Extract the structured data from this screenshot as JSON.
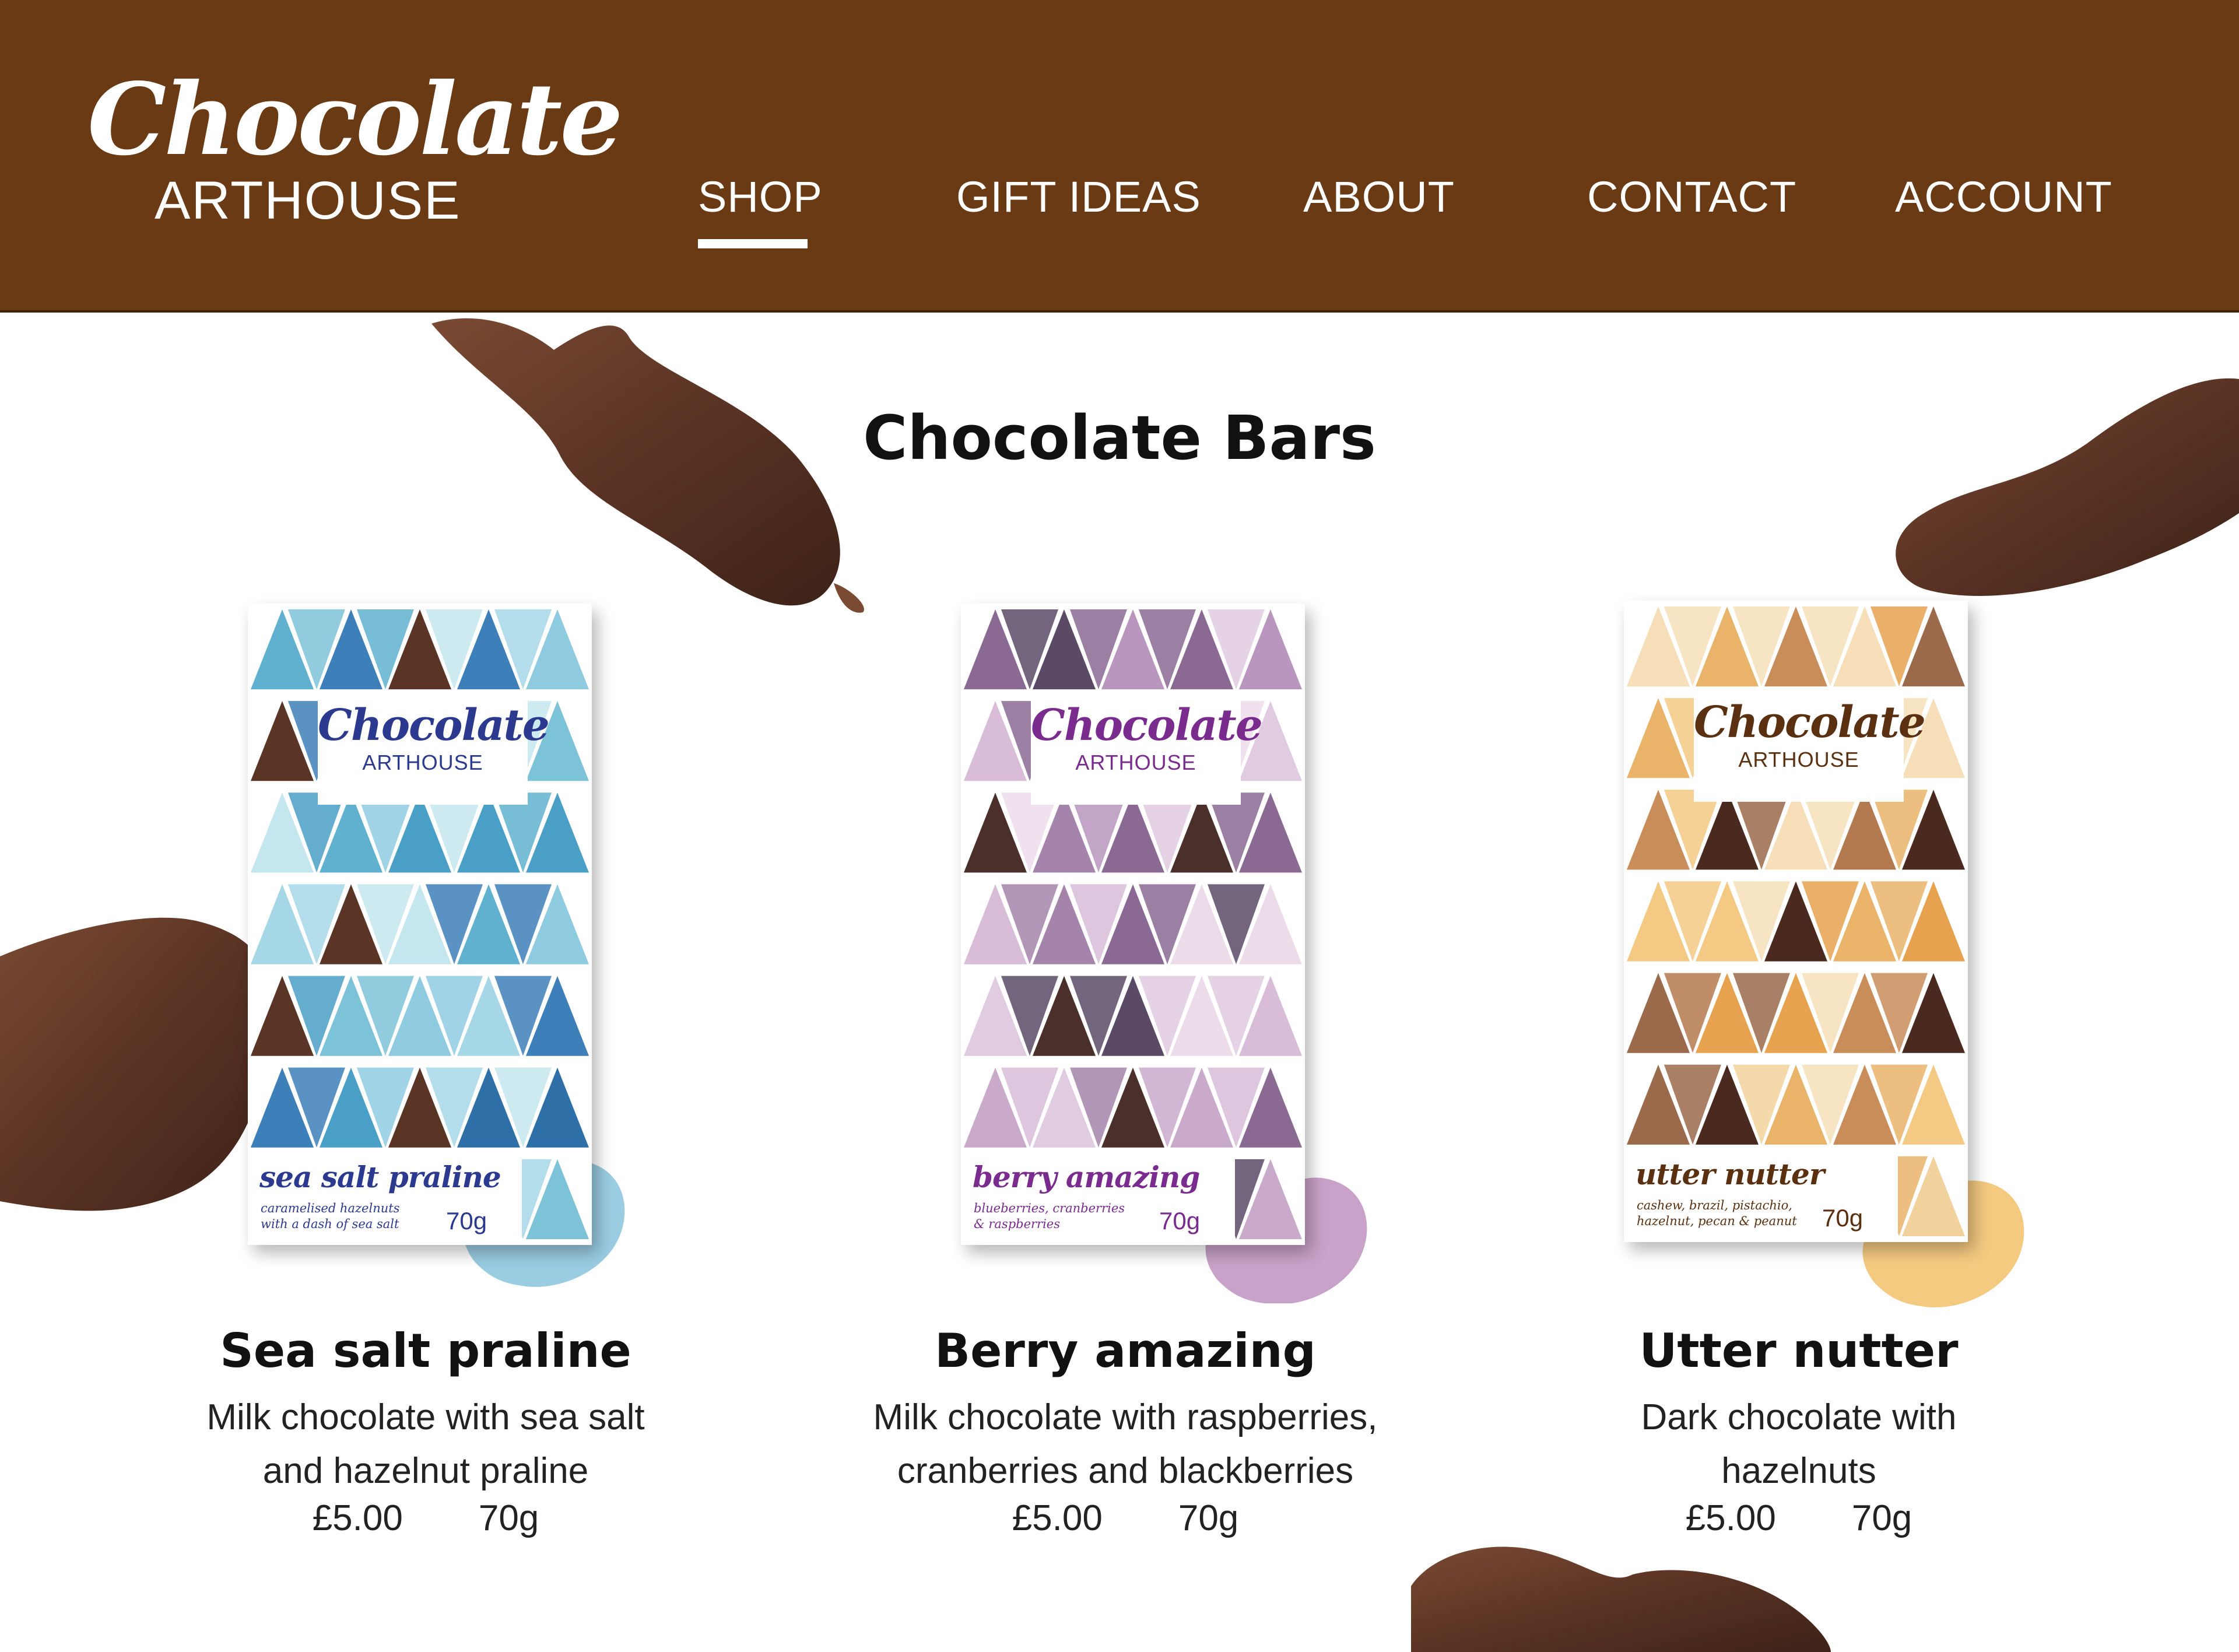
{
  "brand": {
    "script": "Chocolate",
    "sub": "ARTHOUSE"
  },
  "nav": {
    "items": [
      {
        "label": "SHOP",
        "active": true
      },
      {
        "label": "GIFT IDEAS",
        "active": false
      },
      {
        "label": "ABOUT",
        "active": false
      },
      {
        "label": "CONTACT",
        "active": false
      },
      {
        "label": "ACCOUNT",
        "active": false
      }
    ]
  },
  "page": {
    "title": "Chocolate Bars"
  },
  "products": [
    {
      "name": "Sea salt praline",
      "desc_line1": "Milk chocolate with sea salt",
      "desc_line2": "and hazelnut praline",
      "price": "£5.00",
      "weight": "70g",
      "pack": {
        "brand": "Chocolate",
        "brand_sub": "ARTHOUSE",
        "name": "sea salt praline",
        "desc_line1": "caramelised hazelnuts",
        "desc_line2": "with a dash of sea salt",
        "weight": "70g",
        "ink": "#2b3a8f",
        "palette": [
          "#7cc3d8",
          "#4a9fc7",
          "#a6d7e6",
          "#3d7fb9",
          "#5fb1cf",
          "#8fcbe0",
          "#2f6fa8",
          "#c4e6ef"
        ],
        "chocolate": "#5a3526",
        "splash": "#6fb7d6"
      }
    },
    {
      "name": "Berry amazing",
      "desc_line1": "Milk chocolate with raspberries,",
      "desc_line2": "cranberries and blackberries",
      "price": "£5.00",
      "weight": "70g",
      "pack": {
        "brand": "Chocolate",
        "brand_sub": "ARTHOUSE",
        "name": "berry amazing",
        "desc_line1": "blueberries, cranberries",
        "desc_line2": "& raspberries",
        "weight": "70g",
        "ink": "#7a2b8e",
        "palette": [
          "#c9aacb",
          "#a484ab",
          "#e0cbe0",
          "#8a6a93",
          "#b996bd",
          "#d8bcd8",
          "#5b4a66",
          "#ecdcea"
        ],
        "chocolate": "#4a2f2a",
        "splash": "#b27ab2"
      }
    },
    {
      "name": "Utter nutter",
      "desc_line1": "Dark chocolate with",
      "desc_line2": "hazelnuts",
      "price": "£5.00",
      "weight": "70g",
      "pack": {
        "brand": "Chocolate",
        "brand_sub": "ARTHOUSE",
        "name": "utter nutter",
        "desc_line1": "cashew, brazil, pistachio,",
        "desc_line2": "hazelnut, pecan & peanut",
        "weight": "70g",
        "ink": "#5a3010",
        "palette": [
          "#e9b46a",
          "#f3c983",
          "#c98d5a",
          "#f6dfb8",
          "#b47a4f",
          "#e6a24f",
          "#f2d29c",
          "#9a6a4a"
        ],
        "chocolate": "#4a2a1f",
        "splash": "#f0b24a"
      }
    }
  ],
  "colors": {
    "header_bg": "#693a13",
    "header_text": "#ffffff",
    "splash_chocolate": "#5c3424"
  }
}
